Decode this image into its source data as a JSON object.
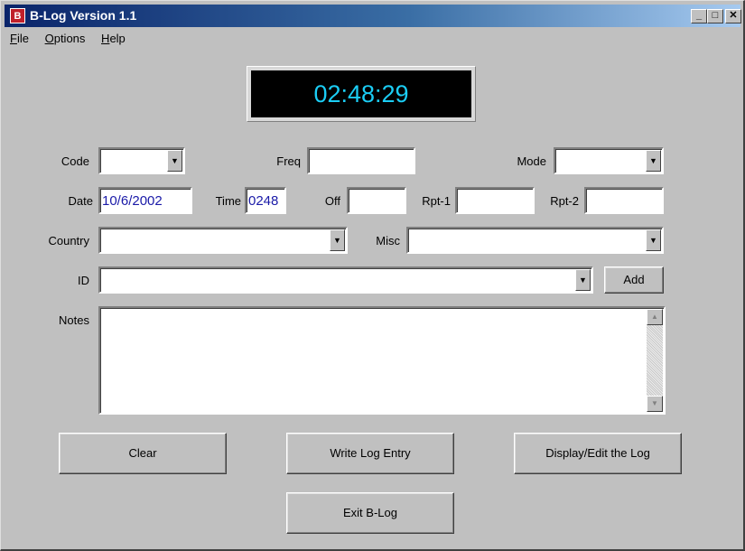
{
  "window": {
    "title": "B-Log Version 1.1",
    "icon_letter": "B",
    "min_glyph": "_",
    "max_glyph": "□",
    "close_glyph": "✕"
  },
  "menu": [
    {
      "ul": "F",
      "rest": "ile"
    },
    {
      "ul": "O",
      "rest": "ptions"
    },
    {
      "ul": "H",
      "rest": "elp"
    }
  ],
  "clock": {
    "time": "02:48:29"
  },
  "labels": {
    "code": "Code",
    "freq": "Freq",
    "mode": "Mode",
    "date": "Date",
    "time": "Time",
    "off": "Off",
    "rpt1": "Rpt-1",
    "rpt2": "Rpt-2",
    "country": "Country",
    "misc": "Misc",
    "id": "ID",
    "notes": "Notes"
  },
  "fields": {
    "code": "",
    "freq": "",
    "mode": "",
    "date": "10/6/2002",
    "time": "0248",
    "off": "",
    "rpt1": "",
    "rpt2": "",
    "country": "",
    "misc": "",
    "id": "",
    "notes": ""
  },
  "buttons": {
    "add": "Add",
    "clear": "Clear",
    "write": "Write Log Entry",
    "display": "Display/Edit the Log",
    "exit": "Exit B-Log"
  },
  "glyphs": {
    "dropdown": "▼",
    "scroll_up": "▲",
    "scroll_down": "▼"
  },
  "colors": {
    "clock_text": "#1bcdf5",
    "field_text": "#1a1aa8"
  }
}
